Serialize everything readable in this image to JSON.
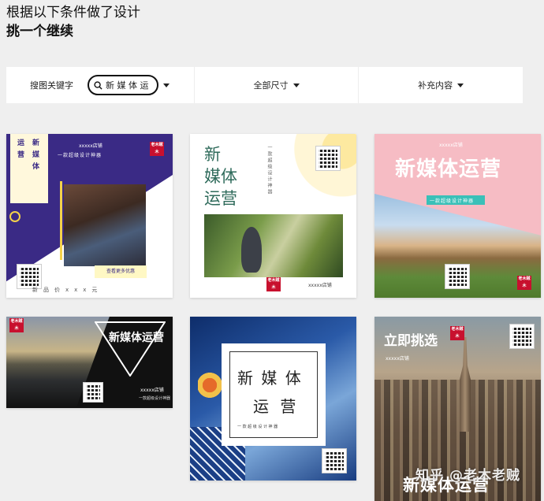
{
  "heading": {
    "line1": "根据以下条件做了设计",
    "line2": "挑一个继续"
  },
  "filters": {
    "keyword_label": "搜图关键字",
    "keyword_value": "新 媒 体 运",
    "size_label": "全部尺寸",
    "supplement_label": "补充内容"
  },
  "icons": {
    "search": "search-icon",
    "caret": "chevron-down-icon"
  },
  "cards": [
    {
      "vertical_left": "运营",
      "vertical_right": "新媒体",
      "shop": "xxxxx店铺",
      "tagline": "一款超级设计神器",
      "seal": "老木贼木",
      "cta": "查看更多优惠",
      "price": "新　品　价　x　x　x　元"
    },
    {
      "title_line1": "新",
      "title_line2": "媒体",
      "title_line3": "运营",
      "vertical_caption": "一款超级设计神器",
      "shop": "xxxxx店铺",
      "seal": "老木贼木"
    },
    {
      "shop": "xxxxx店铺",
      "title": "新媒体运营",
      "tagline": "一款超级设计神器",
      "seal": "老木贼木"
    },
    {
      "seal": "老木贼木",
      "title": "新媒体运营",
      "shop": "xxxxx店铺",
      "tagline": "一款超级设计神器"
    },
    {
      "title_line1": "新 媒 体",
      "title_line2": "运 营",
      "tagline": "一 款 超 级 设 计 神 器"
    },
    {
      "title": "立即挑选",
      "shop": "xxxxx店铺",
      "seal": "老木贼木",
      "bottom_title": "新媒体运营"
    }
  ],
  "watermark": "知乎 @老木老贼"
}
